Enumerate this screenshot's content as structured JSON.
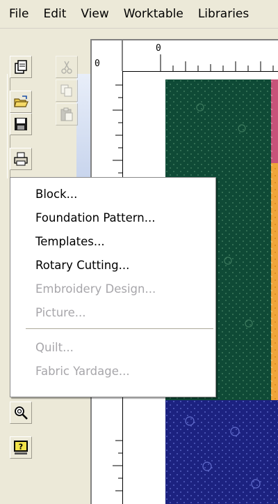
{
  "menubar": {
    "items": [
      "File",
      "Edit",
      "View",
      "Worktable",
      "Libraries"
    ]
  },
  "ruler": {
    "top_label": "0",
    "left_label": "0"
  },
  "dropdown": {
    "items": [
      {
        "label": "Block...",
        "enabled": true
      },
      {
        "label": "Foundation Pattern...",
        "enabled": true
      },
      {
        "label": "Templates...",
        "enabled": true
      },
      {
        "label": "Rotary Cutting...",
        "enabled": true
      },
      {
        "label": "Embroidery Design...",
        "enabled": false
      },
      {
        "label": "Picture...",
        "enabled": false
      },
      {
        "label": "Quilt...",
        "enabled": false
      },
      {
        "label": "Fabric Yardage...",
        "enabled": false
      }
    ]
  },
  "colors": {
    "fabric_green": "#0f4a36",
    "fabric_blue": "#1c2280",
    "fabric_pink": "#c8527a",
    "fabric_orange": "#f0a53a",
    "fabric_gold": "#d98a1c",
    "disabled_text": "#a7a6aa"
  }
}
